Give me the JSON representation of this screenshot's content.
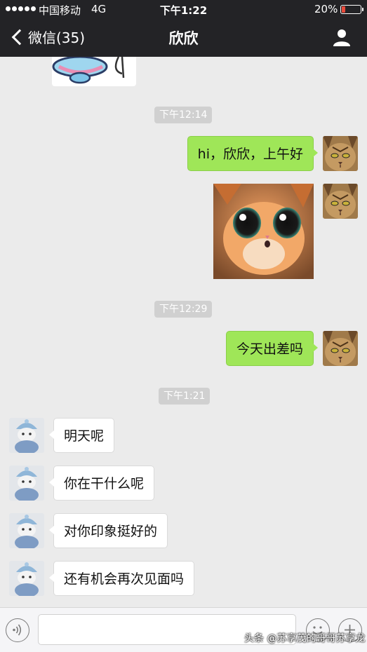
{
  "status_bar": {
    "carrier": "中国移动",
    "network": "4G",
    "time": "下午1:22",
    "battery_percent": "20%",
    "battery_level": 0.2
  },
  "nav": {
    "back_label": "微信(35)",
    "title": "欣欣",
    "profile_icon": "person-icon"
  },
  "messages": {
    "t1": "下午12:14",
    "m1": "hi，欣欣，上午好",
    "t2": "下午12:29",
    "m3": "今天出差吗",
    "t3": "下午1:21",
    "m4": "明天呢",
    "m5": "你在干什么呢",
    "m6": "对你印象挺好的",
    "m7": "还有机会再次见面吗"
  },
  "input_bar": {
    "voice_icon": "voice-icon",
    "emoji_icon": "emoji-icon",
    "plus_icon": "plus-icon",
    "placeholder": ""
  },
  "watermark": "头条 @苏享茂的哥哥苏享龙",
  "colors": {
    "header": "#232326",
    "outgoing_bubble": "#9fe658",
    "incoming_bubble": "#ffffff",
    "chat_background": "#ebebeb",
    "battery_low": "#e94b3c"
  }
}
